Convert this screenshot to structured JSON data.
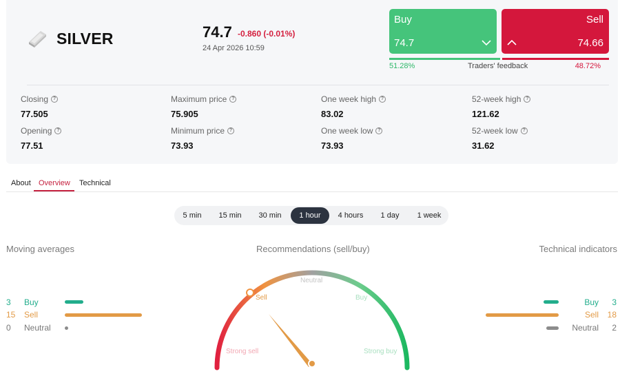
{
  "asset": {
    "name": "SILVER",
    "price": "74.7",
    "change": "-0.860 (-0.01%)",
    "datetime": "24 Apr 2026 10:59",
    "icon": "silver-bar-icon"
  },
  "trade": {
    "buy_label": "Buy",
    "buy_price": "74.7",
    "sell_label": "Sell",
    "sell_price": "74.66",
    "buy_color": "#45c47b",
    "sell_color": "#d4173c"
  },
  "feedback": {
    "buy_pct": "51.28%",
    "label": "Traders' feedback",
    "sell_pct": "48.72%"
  },
  "stats": [
    {
      "label": "Closing",
      "value": "77.505"
    },
    {
      "label": "Maximum price",
      "value": "75.905"
    },
    {
      "label": "One week high",
      "value": "83.02"
    },
    {
      "label": "52-week high",
      "value": "121.62"
    },
    {
      "label": "Opening",
      "value": "77.51"
    },
    {
      "label": "Minimum price",
      "value": "73.93"
    },
    {
      "label": "One week low",
      "value": "73.93"
    },
    {
      "label": "52-week low",
      "value": "31.62"
    }
  ],
  "tabs": [
    {
      "label": "About"
    },
    {
      "label": "Overview",
      "active": true
    },
    {
      "label": "Technical"
    }
  ],
  "timeframes": [
    {
      "label": "5 min"
    },
    {
      "label": "15 min"
    },
    {
      "label": "30 min"
    },
    {
      "label": "1 hour",
      "active": true
    },
    {
      "label": "4 hours"
    },
    {
      "label": "1 day"
    },
    {
      "label": "1 week"
    }
  ],
  "moving_averages": {
    "title": "Moving averages",
    "buy_count": "3",
    "buy_label": "Buy",
    "sell_count": "15",
    "sell_label": "Sell",
    "neutral_count": "0",
    "neutral_label": "Neutral"
  },
  "recommendations": {
    "title": "Recommendations (sell/buy)",
    "labels": {
      "strong_sell": "Strong sell",
      "sell": "Sell",
      "neutral": "Neutral",
      "buy": "Buy",
      "strong_buy": "Strong buy"
    },
    "active": "Sell"
  },
  "technical_indicators": {
    "title": "Technical indicators",
    "buy_count": "3",
    "buy_label": "Buy",
    "sell_count": "18",
    "sell_label": "Sell",
    "neutral_count": "2",
    "neutral_label": "Neutral"
  },
  "colors": {
    "accent": "#c5213f",
    "green": "#22ad8c",
    "orange": "#e29a46",
    "neutral": "#8c8c8c"
  }
}
